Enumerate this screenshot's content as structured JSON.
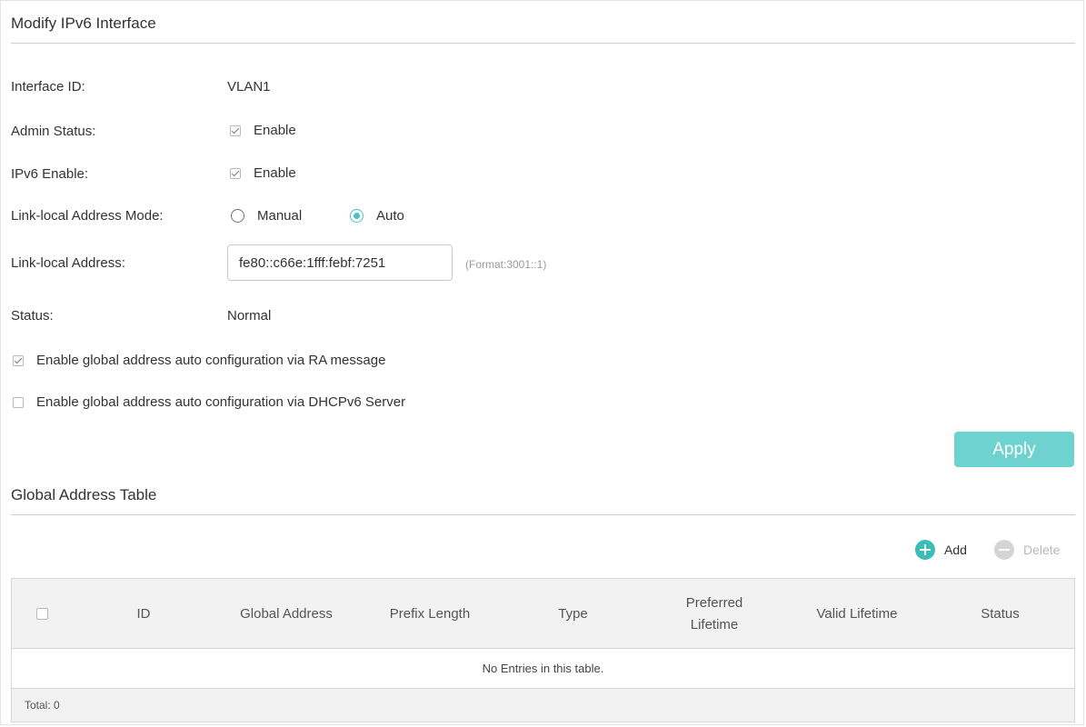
{
  "form": {
    "title": "Modify IPv6 Interface",
    "interface_id_label": "Interface ID:",
    "interface_id_value": "VLAN1",
    "admin_status_label": "Admin Status:",
    "admin_status_option": "Enable",
    "ipv6_enable_label": "IPv6 Enable:",
    "ipv6_enable_option": "Enable",
    "link_local_mode_label": "Link-local Address Mode:",
    "mode_manual": "Manual",
    "mode_auto": "Auto",
    "link_local_address_label": "Link-local Address:",
    "link_local_address_value": "fe80::c66e:1fff:febf:7251",
    "link_local_address_hint": "(Format:3001::1)",
    "status_label": "Status:",
    "status_value": "Normal",
    "ra_option": "Enable global address auto configuration via RA message",
    "dhcp_option": "Enable global address auto configuration via DHCPv6 Server",
    "apply_label": "Apply"
  },
  "table": {
    "title": "Global Address Table",
    "add_label": "Add",
    "delete_label": "Delete",
    "columns": {
      "id": "ID",
      "global_address": "Global Address",
      "prefix_length": "Prefix Length",
      "type": "Type",
      "preferred_lifetime_1": "Preferred",
      "preferred_lifetime_2": "Lifetime",
      "valid_lifetime": "Valid Lifetime",
      "status": "Status"
    },
    "empty_message": "No Entries in this table.",
    "total_label": "Total: 0"
  },
  "colors": {
    "accent": "#48c2c2",
    "apply_button": "#6ed2d0",
    "add_icon": "#3dbdba",
    "delete_icon": "#d4d4d4"
  },
  "icons": {
    "add": "plus-circle-icon",
    "delete": "minus-circle-icon"
  }
}
